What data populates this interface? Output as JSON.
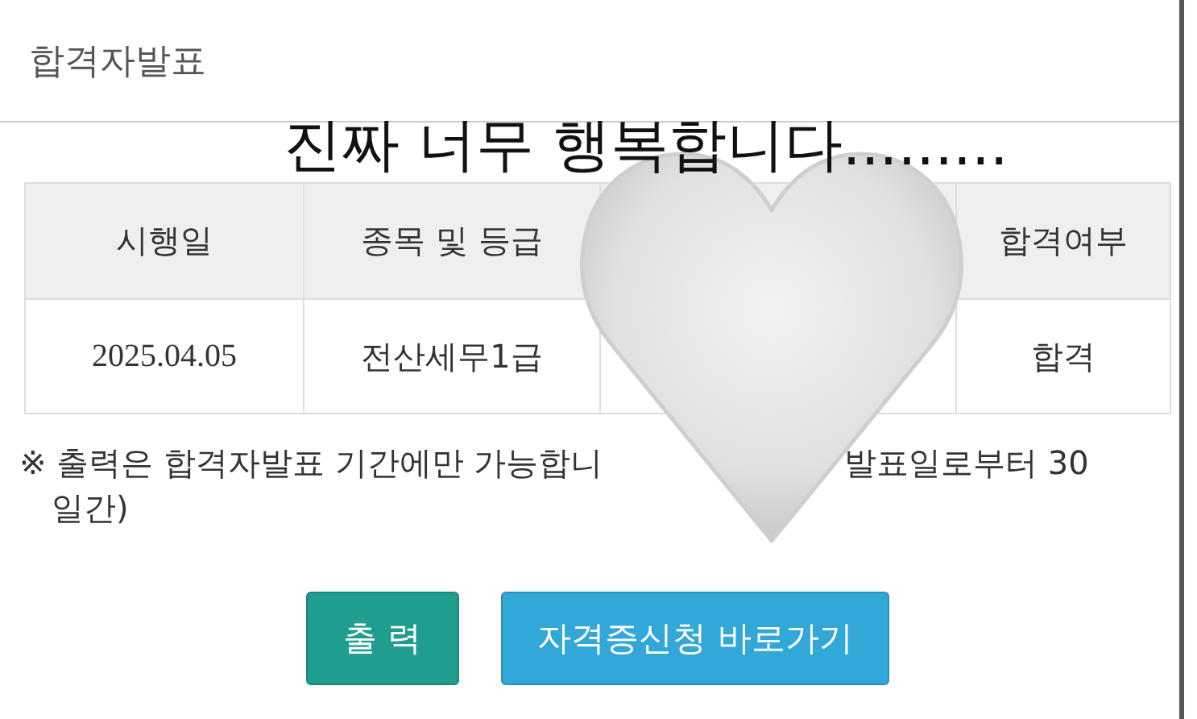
{
  "page_title": "합격자발표",
  "caption": "진짜 너무 행복합니다.........",
  "table": {
    "columns": [
      "시행일",
      "종목 및 등급",
      "합격여부"
    ],
    "rows": [
      [
        "2025.04.05",
        "전산세무1급",
        "합격"
      ]
    ]
  },
  "note": {
    "line_start": "※ 출력은 합격자발표 기간에만 가능합니",
    "line_end": "발표일로부터 30",
    "continuation": "일간)"
  },
  "buttons": [
    {
      "label": "출 력",
      "kind": "print"
    },
    {
      "label": "자격증신청 바로가기",
      "kind": "link"
    }
  ]
}
